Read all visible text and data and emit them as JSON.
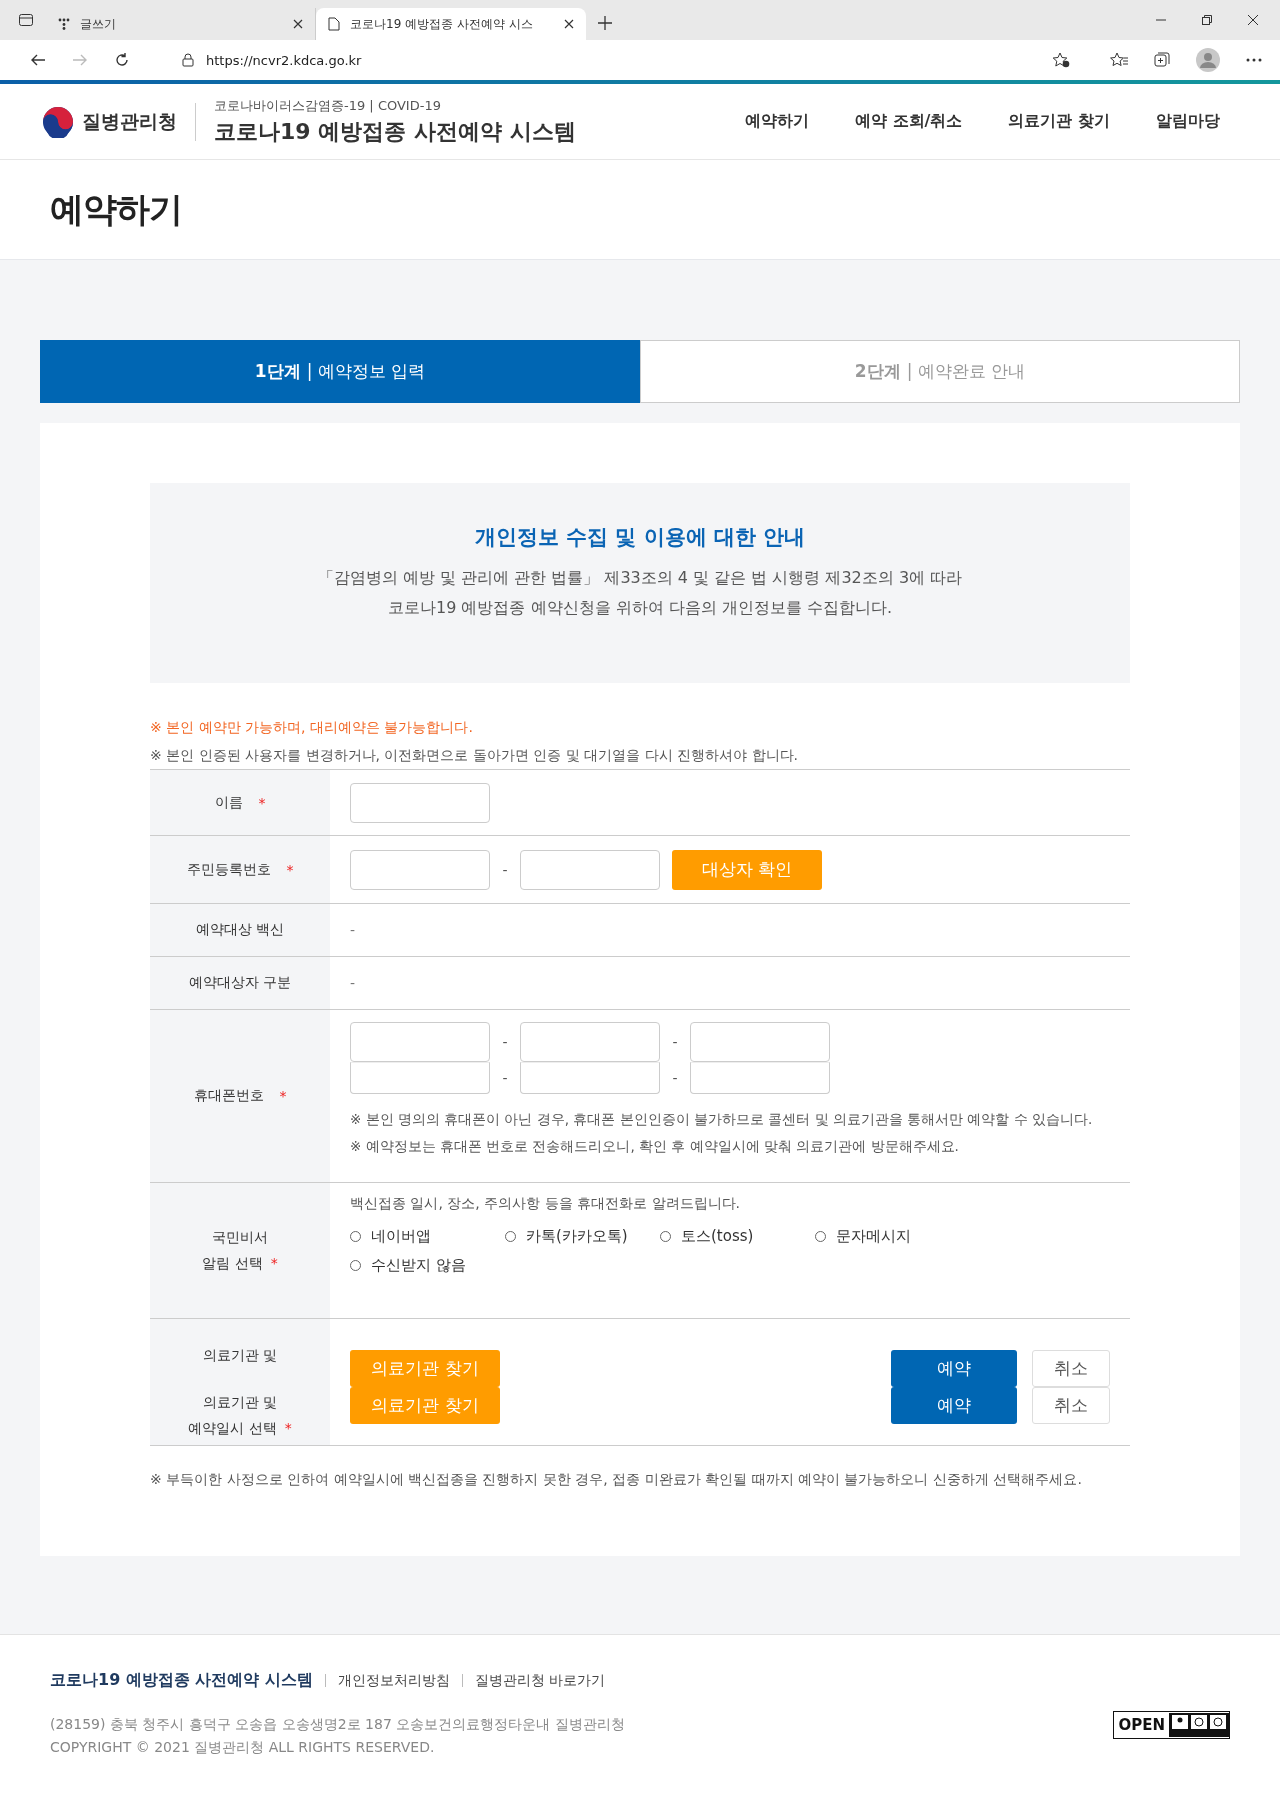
{
  "browser": {
    "tabs": [
      {
        "title": "글쓰기",
        "selected": false
      },
      {
        "title": "코로나19 예방접종 사전예약 시스",
        "selected": true
      }
    ],
    "url": "https://ncvr2.kdca.go.kr"
  },
  "header": {
    "logo_text": "질병관리청",
    "subtitle": "코로나바이러스감염증-19 | COVID-19",
    "title": "코로나19 예방접종 사전예약 시스템",
    "nav": [
      "예약하기",
      "예약 조회/취소",
      "의료기관 찾기",
      "알림마당"
    ]
  },
  "page_title": "예약하기",
  "steps": [
    {
      "text": "**1단계** | 예약정보 입력",
      "selected": true
    },
    {
      "text": "**2단계** | 예약완료 안내",
      "selected": false
    }
  ],
  "notice": {
    "title": "개인정보 수집 및 이용에 대한 안내",
    "lines": [
      "「감염병의 예방 및 관리에 관한 법률」 제33조의 4 및 같은 법 시행령 제32조의 3에 따라",
      "코로나19 예방접종 예약신청을 위하여 다음의 개인정보를 수집합니다."
    ]
  },
  "warnings": [
    {
      "kind": "alert",
      "text": "※ 본인 예약만 가능하며, 대리예약은 불가능합니다."
    },
    {
      "kind": "info",
      "text": "※ 본인 인증된 사용자를 변경하거나, 이전화면으로 돌아가면 인증 및 대기열을 다시 진행하셔야 합니다."
    }
  ],
  "required_mark": "*",
  "rows": [
    {
      "kind": "name",
      "label": "이름",
      "required": true
    },
    {
      "kind": "rrn",
      "label": "주민등록번호",
      "required": true,
      "separator": "-",
      "button": "대상자 확인"
    },
    {
      "kind": "text",
      "label": "예약대상 백신",
      "required": false,
      "value": "-"
    },
    {
      "kind": "text",
      "label": "예약대상자 구분",
      "required": false,
      "value": "-"
    },
    {
      "kind": "phone",
      "label": "휴대폰번호",
      "required": true,
      "separators": [
        "-",
        "-",
        "-",
        "-"
      ],
      "notes": [
        "※ 본인 명의의 휴대폰이 아닌 경우, 휴대폰 본인인증이 불가하므로 콜센터 및 의료기관을 통해서만 예약할 수 있습니다.",
        "※ 예약정보는 휴대폰 번호로 전송해드리오니, 확인 후 예약일시에 맞춰 의료기관에 방문해주세요."
      ]
    },
    {
      "kind": "radio",
      "label_lines": [
        "국민비서",
        "알림 선택"
      ],
      "required": true,
      "hint": "백신접종 일시, 장소, 주의사항 등을 휴대전화로 알려드립니다.",
      "options": [
        {
          "label": "네이버앱",
          "selected": false
        },
        {
          "label": "카톡(카카오톡)",
          "selected": false
        },
        {
          "label": "토스(toss)",
          "selected": false
        },
        {
          "label": "문자메시지",
          "selected": false
        },
        {
          "label": "수신받지 않음",
          "selected": false
        }
      ]
    },
    {
      "kind": "hospital",
      "lines": [
        {
          "label_lines": [
            "의료기관 및"
          ],
          "required": false,
          "find": "의료기관 찾기",
          "reserve": "예약",
          "cancel": "취소"
        },
        {
          "label_lines": [
            "의료기관 및",
            "예약일시 선택"
          ],
          "required": true,
          "find": "의료기관 찾기",
          "reserve": "예약",
          "cancel": "취소"
        }
      ]
    }
  ],
  "footnote": "※ 부득이한 사정으로 인하여 예약일시에 백신접종을 진행하지 못한 경우, 접종 미완료가 확인될 때까지 예약이 불가능하오니 신중하게 선택해주세요.",
  "footer": {
    "title": "코로나19 예방접종 사전예약 시스템",
    "links": [
      "개인정보처리방침",
      "질병관리청 바로가기"
    ],
    "address": "(28159) 충북 청주시 흥덕구 오송읍 오송생명2로 187 오송보건의료행정타운내 질병관리청",
    "copyright": "COPYRIGHT © 2021 질병관리청 ALL RIGHTS RESERVED.",
    "badge": "OPEN"
  }
}
